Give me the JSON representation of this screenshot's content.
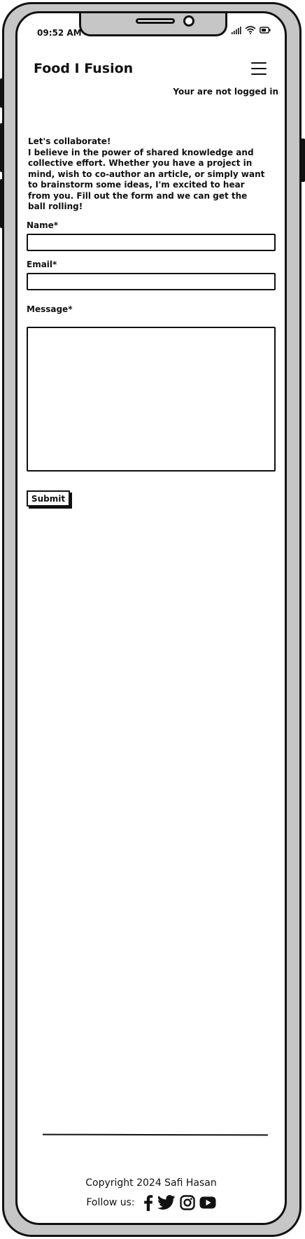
{
  "status_bar": {
    "time": "09:52 AM"
  },
  "header": {
    "brand": "Food I Fusion",
    "login_status": "Your are not logged in"
  },
  "intro": {
    "lines": [
      "Let's collaborate!",
      "I believe in the power of shared knowledge and collective effort. Whether you have a project in mind, wish to co-author an article, or simply want to brainstorm some ideas, I'm excited to hear from you. Fill out the form and we can get the ball rolling!"
    ]
  },
  "form": {
    "name_label": "Name*",
    "name_value": "",
    "email_label": "Email*",
    "email_value": "",
    "message_label": "Message*",
    "message_value": "",
    "submit_label": "Submit"
  },
  "footer": {
    "copyright": "Copyright 2024 Safi Hasan",
    "follow_label": "Follow us:",
    "social_icons": [
      "facebook-icon",
      "twitter-icon",
      "instagram-icon",
      "youtube-icon"
    ]
  }
}
